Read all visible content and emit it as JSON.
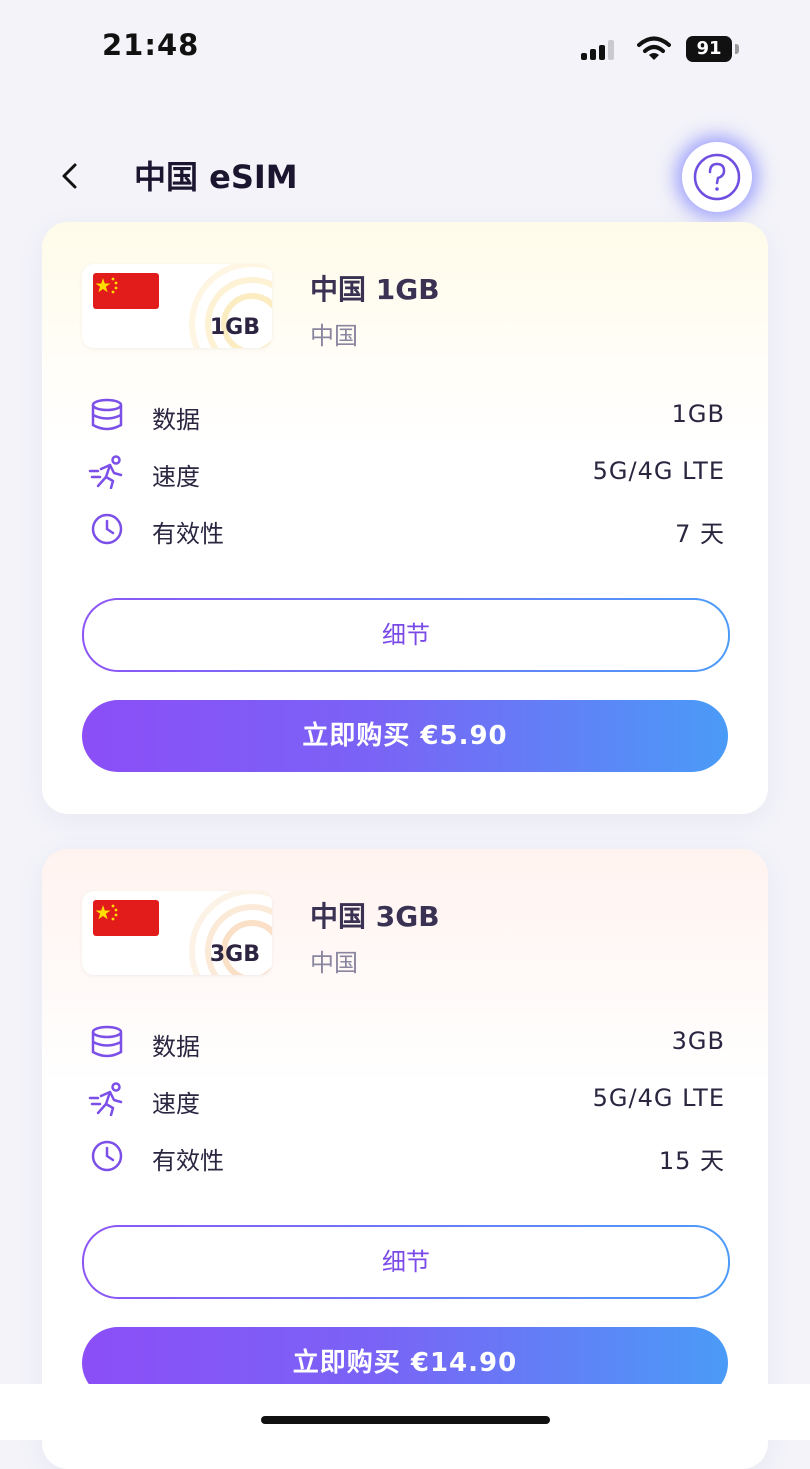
{
  "status_bar": {
    "time": "21:48",
    "battery": "91"
  },
  "nav": {
    "title": "中国 eSIM",
    "back_icon": "chevron-left-icon",
    "help_icon": "question-circle-icon"
  },
  "colors": {
    "accent_purple": "#8b4ef7",
    "accent_blue": "#4a9bf7",
    "icon_purple": "#7b4fe8"
  },
  "plans": [
    {
      "badge": "1GB",
      "name": "中国 1GB",
      "country": "中国",
      "rows": [
        {
          "icon": "database-icon",
          "label": "数据",
          "value": "1GB"
        },
        {
          "icon": "running-icon",
          "label": "速度",
          "value": "5G/4G LTE"
        },
        {
          "icon": "clock-icon",
          "label": "有效性",
          "value": "7 天"
        }
      ],
      "details_label": "细节",
      "buy_label": "立即购买 €5.90"
    },
    {
      "badge": "3GB",
      "name": "中国 3GB",
      "country": "中国",
      "rows": [
        {
          "icon": "database-icon",
          "label": "数据",
          "value": "3GB"
        },
        {
          "icon": "running-icon",
          "label": "速度",
          "value": "5G/4G LTE"
        },
        {
          "icon": "clock-icon",
          "label": "有效性",
          "value": "15 天"
        }
      ],
      "details_label": "细节",
      "buy_label": "立即购买 €14.90"
    }
  ]
}
